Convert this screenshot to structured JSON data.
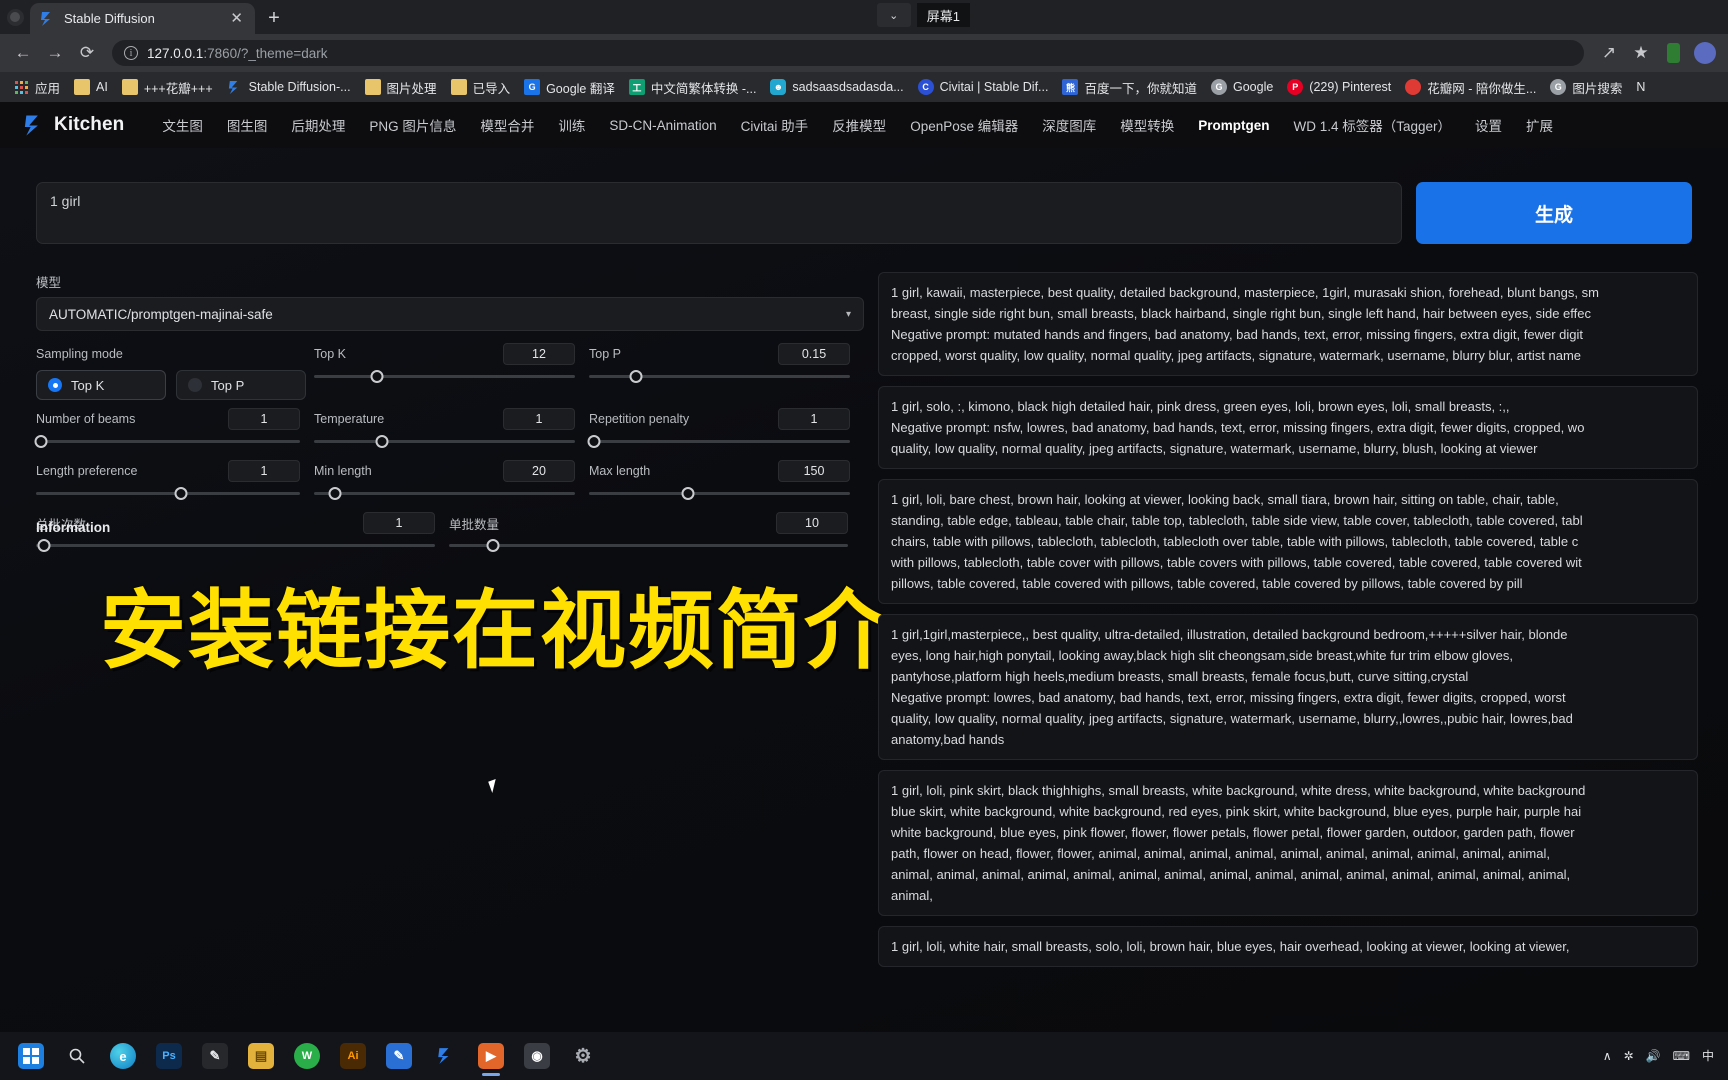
{
  "browser": {
    "tab": {
      "title": "Stable Diffusion",
      "favicon": "stable-diffusion-icon",
      "close": "✕"
    },
    "newtab_label": "+",
    "screen_chip": {
      "arrow": "⌄",
      "label": "屏幕1"
    },
    "toolbar": {
      "back": "←",
      "forward": "→",
      "reload": "⟳",
      "url_main": "127.0.0.1",
      "url_rest": ":7860/?_theme=dark",
      "info_icon": "ⓘ",
      "share": "↗",
      "star": "★"
    },
    "bookmarks": [
      {
        "label": "应用",
        "icon": "apps-grid-icon"
      },
      {
        "label": "AI",
        "icon": "folder-icon"
      },
      {
        "label": "+++花瓣+++",
        "icon": "folder-icon"
      },
      {
        "label": "Stable Diffusion-...",
        "icon": "stable-diffusion-icon"
      },
      {
        "label": "图片处理",
        "icon": "folder-icon"
      },
      {
        "label": "已导入",
        "icon": "folder-icon"
      },
      {
        "label": "Google 翻译",
        "icon": "google-translate-icon"
      },
      {
        "label": "中文简繁体转换 -...",
        "icon": "converter-icon"
      },
      {
        "label": "sadsaasdsadasda...",
        "icon": "robot-icon"
      },
      {
        "label": "Civitai | Stable Dif...",
        "icon": "civitai-icon"
      },
      {
        "label": "百度一下，你就知道",
        "icon": "baidu-icon"
      },
      {
        "label": "Google",
        "icon": "google-icon"
      },
      {
        "label": "(229) Pinterest",
        "icon": "pinterest-icon"
      },
      {
        "label": "花瓣网 - 陪你做生...",
        "icon": "huaban-icon"
      },
      {
        "label": "图片搜索",
        "icon": "image-search-icon"
      },
      {
        "label": "N",
        "icon": "generic-icon"
      }
    ]
  },
  "app": {
    "brand": "Kitchen",
    "nav": [
      {
        "label": "文生图",
        "active": false
      },
      {
        "label": "图生图",
        "active": false
      },
      {
        "label": "后期处理",
        "active": false
      },
      {
        "label": "PNG 图片信息",
        "active": false
      },
      {
        "label": "模型合并",
        "active": false
      },
      {
        "label": "训练",
        "active": false
      },
      {
        "label": "SD-CN-Animation",
        "active": false
      },
      {
        "label": "Civitai 助手",
        "active": false
      },
      {
        "label": "反推模型",
        "active": false
      },
      {
        "label": "OpenPose 编辑器",
        "active": false
      },
      {
        "label": "深度图库",
        "active": false
      },
      {
        "label": "模型转换",
        "active": false
      },
      {
        "label": "Promptgen",
        "active": true
      },
      {
        "label": "WD 1.4 标签器（Tagger）",
        "active": false
      },
      {
        "label": "设置",
        "active": false
      },
      {
        "label": "扩展",
        "active": false
      }
    ],
    "prompt": {
      "value": "1 girl",
      "placeholder": ""
    },
    "generate_label": "生成",
    "model": {
      "label": "模型",
      "value": "AUTOMATIC/promptgen-majinai-safe"
    },
    "sampling_mode": {
      "label": "Sampling mode",
      "options": [
        {
          "label": "Top K",
          "selected": true
        },
        {
          "label": "Top P",
          "selected": false
        }
      ]
    },
    "params": [
      {
        "name": "Number of beams",
        "value": "1",
        "pct": 2
      },
      {
        "name": "Top K",
        "value": "12",
        "pct": 24
      },
      {
        "name": "Top P",
        "value": "0.15",
        "pct": 18
      },
      {
        "name": "Length preference",
        "value": "1",
        "pct": 55
      },
      {
        "name": "Temperature",
        "value": "1",
        "pct": 26
      },
      {
        "name": "Repetition penalty",
        "value": "1",
        "pct": 2
      },
      {
        "name": "总批次数",
        "value": "1",
        "pct": 2
      },
      {
        "name": "Min length",
        "value": "20",
        "pct": 8
      },
      {
        "name": "Max length",
        "value": "150",
        "pct": 38
      },
      {
        "name": "单批数量",
        "value": "10",
        "pct": 16
      }
    ],
    "information_label": "Information",
    "overlay_text": "安装链接在视频简介",
    "overlay_color": "#ffe000",
    "accent_color": "#1972e8",
    "outputs": [
      {
        "lines": [
          "1 girl, kawaii, masterpiece, best quality, detailed background, masterpiece, 1girl, murasaki shion, forehead, blunt bangs, sm",
          "breast, single side right bun, small breasts, black hairband, single right bun, single left hand, hair between eyes, side effec",
          "Negative prompt: mutated hands and fingers, bad anatomy, bad hands, text, error, missing fingers, extra digit, fewer digit",
          "cropped, worst quality, low quality, normal quality, jpeg artifacts, signature, watermark, username, blurry blur, artist name"
        ]
      },
      {
        "lines": [
          "1 girl, solo, :, kimono, black high detailed hair, pink dress, green eyes, loli, brown eyes, loli, small breasts, :,,",
          "Negative prompt: nsfw, lowres, bad anatomy, bad hands, text, error, missing fingers, extra digit, fewer digits, cropped, wo",
          "quality, low quality, normal quality, jpeg artifacts, signature, watermark, username, blurry, blush, looking at viewer"
        ]
      },
      {
        "lines": [
          "1 girl, loli, bare chest, brown hair, looking at viewer, looking back, small tiara, brown hair, sitting on table, chair, table,",
          "standing, table edge, tableau, table chair, table top, tablecloth, table side view, table cover, tablecloth, table covered, tabl",
          "chairs, table with pillows, tablecloth, tablecloth, tablecloth over table, table with pillows, tablecloth, table covered, table c",
          "with pillows, tablecloth, table cover with pillows, table covers with pillows, table covered, table covered, table covered wit",
          "pillows, table covered, table covered with pillows, table covered, table covered by pillows, table covered by pill"
        ]
      },
      {
        "lines": [
          "1 girl,1girl,masterpiece,, best quality, ultra-detailed, illustration, detailed background bedroom,+++++silver hair, blonde",
          "eyes, long hair,high ponytail, looking away,black high slit cheongsam,side breast,white fur trim elbow gloves,",
          "pantyhose,platform high heels,medium breasts, small breasts, female focus,butt, curve sitting,crystal",
          "Negative prompt: lowres, bad anatomy, bad hands, text, error, missing fingers, extra digit, fewer digits, cropped, worst",
          "quality, low quality, normal quality, jpeg artifacts, signature, watermark, username, blurry,,lowres,,pubic hair, lowres,bad",
          "anatomy,bad hands"
        ]
      },
      {
        "lines": [
          "1 girl, loli, pink skirt, black thighhighs, small breasts, white background, white dress, white background, white background",
          "blue skirt, white background, white background, red eyes, pink skirt, white background, blue eyes, purple hair, purple hai",
          "white background, blue eyes, pink flower, flower, flower petals, flower petal, flower garden, outdoor, garden path, flower",
          "path, flower on head, flower, flower, animal, animal, animal, animal, animal, animal, animal, animal, animal, animal,",
          "animal, animal, animal, animal, animal, animal, animal, animal, animal, animal, animal, animal, animal, animal, animal,",
          "animal,"
        ]
      },
      {
        "lines": [
          "1 girl, loli, white hair, small breasts, solo, loli, brown hair, blue eyes, hair overhead, looking at viewer, looking at viewer,"
        ]
      }
    ]
  },
  "taskbar": {
    "items": [
      {
        "name": "start-button",
        "glyph": "⊞",
        "color": "#1d7fe0",
        "active": false
      },
      {
        "name": "search-button",
        "glyph": "🔍",
        "color": "#2a2c31",
        "active": false
      },
      {
        "name": "edge-browser",
        "glyph": "e",
        "color": "#1c9ad6",
        "active": false
      },
      {
        "name": "photoshop-app",
        "glyph": "Ps",
        "color": "#1b4a8a",
        "active": false
      },
      {
        "name": "pen-tool-app",
        "glyph": "✎",
        "color": "#2a2c31",
        "active": false
      },
      {
        "name": "file-explorer",
        "glyph": "📁",
        "color": "#e3b23c",
        "active": false
      },
      {
        "name": "wechat-app",
        "glyph": "W",
        "color": "#2aae4a",
        "active": false
      },
      {
        "name": "illustrator-app",
        "glyph": "Ai",
        "color": "#7a4a12",
        "active": false
      },
      {
        "name": "notes-app",
        "glyph": "✎",
        "color": "#2a6fd4",
        "active": false
      },
      {
        "name": "stable-diffusion-app",
        "glyph": "◤",
        "color": "#1f6fe0",
        "active": false
      },
      {
        "name": "orange-app",
        "glyph": "▶",
        "color": "#e2662a",
        "active": true
      },
      {
        "name": "screenshot-app",
        "glyph": "◉",
        "color": "#3a3d43",
        "active": false
      },
      {
        "name": "settings-app",
        "glyph": "⚙",
        "color": "#565a61",
        "active": false
      }
    ],
    "tray": [
      "∧",
      "✲",
      "🔊",
      "⌨",
      "中"
    ]
  }
}
